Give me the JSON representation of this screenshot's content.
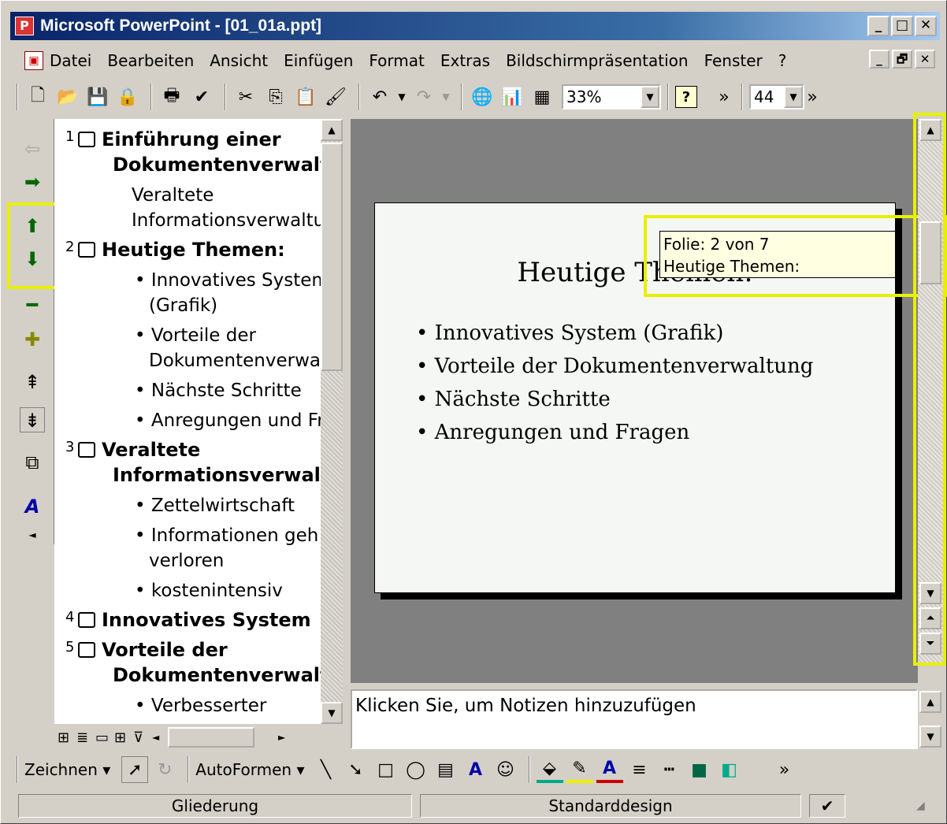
{
  "window": {
    "title": "Microsoft PowerPoint - [01_01a.ppt]",
    "minimize": "_",
    "maximize": "□",
    "close": "✕",
    "restore": "🗗"
  },
  "menu": {
    "items": [
      "Datei",
      "Bearbeiten",
      "Ansicht",
      "Einfügen",
      "Format",
      "Extras",
      "Bildschirmpräsentation",
      "Fenster",
      "?"
    ]
  },
  "toolbar": {
    "zoom": "33%",
    "font_size": "44",
    "more": "»"
  },
  "outline": {
    "slides": [
      {
        "num": "1",
        "title1": "Einführung einer",
        "title2": "Dokumentenverwalt",
        "sub": [
          "Veraltete",
          "Informationsverwaltu"
        ]
      },
      {
        "num": "2",
        "title1": "Heutige Themen:",
        "bullets": [
          "• Innovatives System",
          "(Grafik)",
          "• Vorteile der",
          "Dokumentenverwa",
          "• Nächste Schritte",
          "• Anregungen und Fr"
        ]
      },
      {
        "num": "3",
        "title1": "Veraltete",
        "title2": "Informationsverwalt",
        "bullets": [
          "• Zettelwirtschaft",
          "• Informationen geh",
          "verloren",
          "• kostenintensiv"
        ]
      },
      {
        "num": "4",
        "title1": "Innovatives System"
      },
      {
        "num": "5",
        "title1": "Vorteile der",
        "title2": "Dokumentenverwalt",
        "bullets": [
          "• Verbesserter"
        ]
      }
    ]
  },
  "slide": {
    "title": "Heutige Themen:",
    "bullets": [
      "Innovatives System (Grafik)",
      "Vorteile der Dokumentenverwaltung",
      "Nächste Schritte",
      "Anregungen und Fragen"
    ]
  },
  "tooltip": {
    "line1": "Folie: 2 von 7",
    "line2": "Heutige Themen:"
  },
  "notes": {
    "placeholder": "Klicken Sie, um Notizen hinzuzufügen"
  },
  "drawbar": {
    "draw": "Zeichnen",
    "autoshapes": "AutoFormen"
  },
  "status": {
    "left": "Gliederung",
    "mid": "Standarddesign"
  },
  "colors": {
    "highlight": "#e8f000",
    "title_start": "#0a246a"
  }
}
